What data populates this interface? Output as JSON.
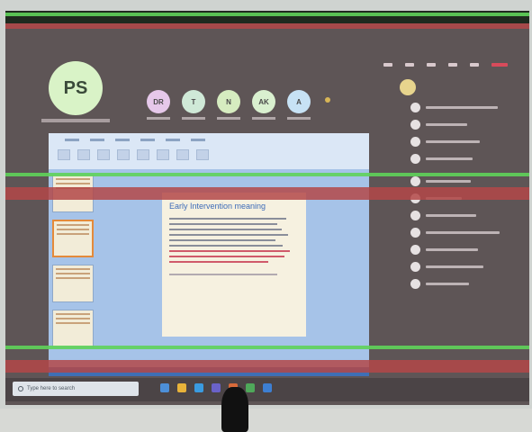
{
  "meeting": {
    "top_label": "",
    "presenter_initials": "PS",
    "participants": [
      {
        "initials": "DR",
        "color": "#e6c8ea"
      },
      {
        "initials": "T",
        "color": "#cfe9d7"
      },
      {
        "initials": "N",
        "color": "#d6ecc0"
      },
      {
        "initials": "AK",
        "color": "#d9f0cf"
      },
      {
        "initials": "A",
        "color": "#c7e2f5"
      }
    ]
  },
  "slide": {
    "title": "Early Intervention meaning"
  },
  "taskbar": {
    "search_placeholder": "Type here to search"
  },
  "colors": {
    "wall": "#5e5556",
    "accent_green": "#5fd35a",
    "accent_red": "#b34848"
  }
}
